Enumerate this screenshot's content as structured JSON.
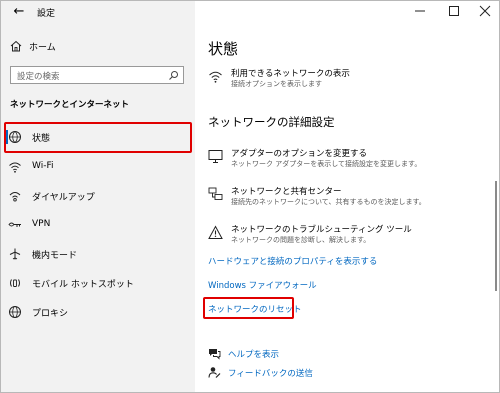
{
  "titlebar": {
    "back_glyph": "←",
    "title": "設定"
  },
  "sidebar": {
    "home_label": "ホーム",
    "search_placeholder": "設定の検索",
    "section_label": "ネットワークとインターネット",
    "items": [
      {
        "label": "状態",
        "icon": "globe-status-icon",
        "active": true
      },
      {
        "label": "Wi-Fi",
        "icon": "wifi-icon"
      },
      {
        "label": "ダイヤルアップ",
        "icon": "dialup-icon"
      },
      {
        "label": "VPN",
        "icon": "vpn-icon"
      },
      {
        "label": "機内モード",
        "icon": "airplane-icon"
      },
      {
        "label": "モバイル ホットスポット",
        "icon": "hotspot-icon"
      },
      {
        "label": "プロキシ",
        "icon": "globe-icon"
      }
    ]
  },
  "main": {
    "title": "状態",
    "available_networks": {
      "title": "利用できるネットワークの表示",
      "desc": "接続オプションを表示します"
    },
    "advanced_heading": "ネットワークの詳細設定",
    "settings": [
      {
        "title": "アダプターのオプションを変更する",
        "desc": "ネットワーク アダプターを表示して接続設定を変更します。",
        "icon": "monitor-icon"
      },
      {
        "title": "ネットワークと共有センター",
        "desc": "接続先のネットワークについて、共有するものを決定します。",
        "icon": "network-sharing-icon"
      },
      {
        "title": "ネットワークのトラブルシューティング ツール",
        "desc": "ネットワークの問題を診断し、解決します。",
        "icon": "warning-icon"
      }
    ],
    "links": [
      "ハードウェアと接続のプロパティを表示する",
      "Windows ファイアウォール",
      "ネットワークのリセット"
    ],
    "help": [
      {
        "label": "ヘルプを表示",
        "icon": "help-chat-icon"
      },
      {
        "label": "フィードバックの送信",
        "icon": "feedback-icon"
      }
    ]
  },
  "colors": {
    "accent": "#0067c0",
    "highlight": "#e00000",
    "sidebar_bg": "#f2f2f2"
  }
}
